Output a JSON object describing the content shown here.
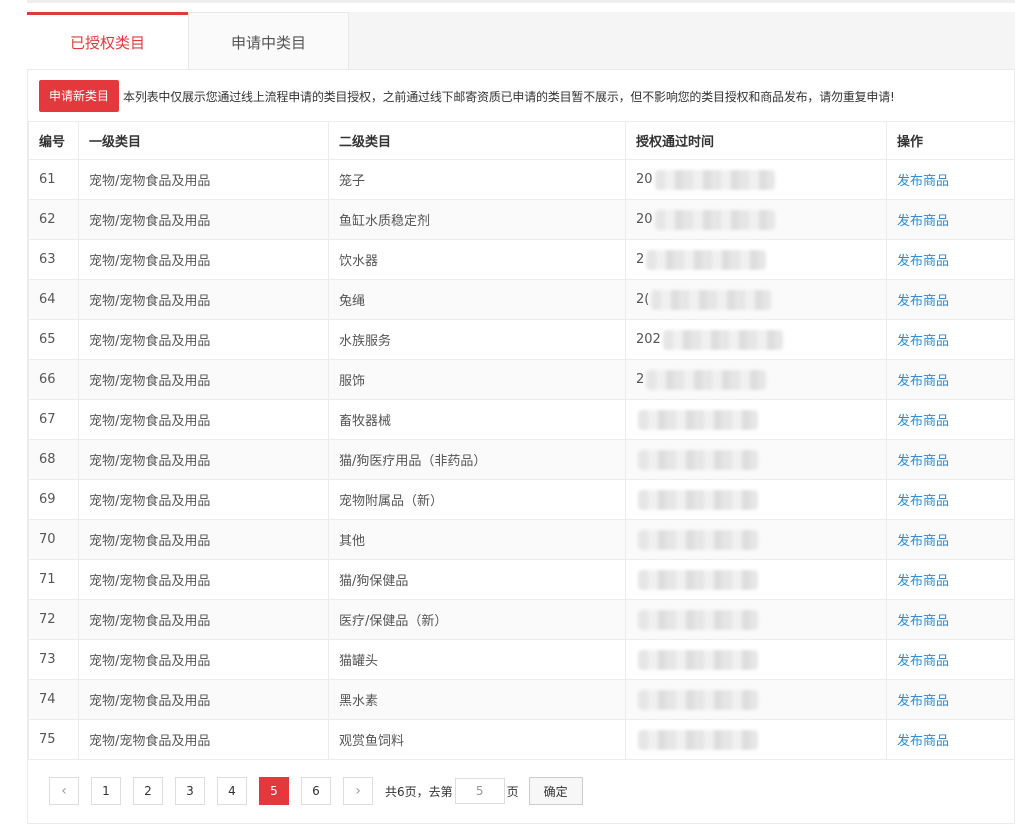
{
  "tabs": [
    {
      "label": "已授权类目",
      "active": true
    },
    {
      "label": "申请中类目",
      "active": false
    }
  ],
  "notice": {
    "button": "申请新类目",
    "text": "本列表中仅展示您通过线上流程申请的类目授权，之前通过线下邮寄资质已申请的类目暂不展示，但不影响您的类目授权和商品发布，请勿重复申请!"
  },
  "table": {
    "headers": [
      "编号",
      "一级类目",
      "二级类目",
      "授权通过时间",
      "操作"
    ],
    "rows": [
      {
        "id": "61",
        "level1": "宠物/宠物食品及用品",
        "level2": "笼子",
        "time": "20",
        "action": "发布商品"
      },
      {
        "id": "62",
        "level1": "宠物/宠物食品及用品",
        "level2": "鱼缸水质稳定剂",
        "time": "20",
        "action": "发布商品"
      },
      {
        "id": "63",
        "level1": "宠物/宠物食品及用品",
        "level2": "饮水器",
        "time": "2",
        "action": "发布商品"
      },
      {
        "id": "64",
        "level1": "宠物/宠物食品及用品",
        "level2": "兔绳",
        "time": "2(",
        "action": "发布商品"
      },
      {
        "id": "65",
        "level1": "宠物/宠物食品及用品",
        "level2": "水族服务",
        "time": "202",
        "action": "发布商品"
      },
      {
        "id": "66",
        "level1": "宠物/宠物食品及用品",
        "level2": "服饰",
        "time": "2",
        "action": "发布商品"
      },
      {
        "id": "67",
        "level1": "宠物/宠物食品及用品",
        "level2": "畜牧器械",
        "time": "",
        "action": "发布商品"
      },
      {
        "id": "68",
        "level1": "宠物/宠物食品及用品",
        "level2": "猫/狗医疗用品（非药品）",
        "time": "",
        "action": "发布商品"
      },
      {
        "id": "69",
        "level1": "宠物/宠物食品及用品",
        "level2": "宠物附属品（新）",
        "time": "",
        "action": "发布商品"
      },
      {
        "id": "70",
        "level1": "宠物/宠物食品及用品",
        "level2": "其他",
        "time": "",
        "action": "发布商品"
      },
      {
        "id": "71",
        "level1": "宠物/宠物食品及用品",
        "level2": "猫/狗保健品",
        "time": "",
        "action": "发布商品"
      },
      {
        "id": "72",
        "level1": "宠物/宠物食品及用品",
        "level2": "医疗/保健品（新）",
        "time": "",
        "action": "发布商品"
      },
      {
        "id": "73",
        "level1": "宠物/宠物食品及用品",
        "level2": "猫罐头",
        "time": "",
        "action": "发布商品"
      },
      {
        "id": "74",
        "level1": "宠物/宠物食品及用品",
        "level2": "黑水素",
        "time": "",
        "action": "发布商品"
      },
      {
        "id": "75",
        "level1": "宠物/宠物食品及用品",
        "level2": "观赏鱼饲料",
        "time": "",
        "action": "发布商品"
      }
    ]
  },
  "pagination": {
    "prev_icon": "chevron-left-icon",
    "next_icon": "chevron-right-icon",
    "pages": [
      "1",
      "2",
      "3",
      "4",
      "5",
      "6"
    ],
    "current": "5",
    "total_text": "共6页，去第",
    "goto_value": "5",
    "page_suffix": "页",
    "confirm": "确定"
  },
  "colors": {
    "accent": "#e4393c",
    "link": "#2a8bd8"
  }
}
